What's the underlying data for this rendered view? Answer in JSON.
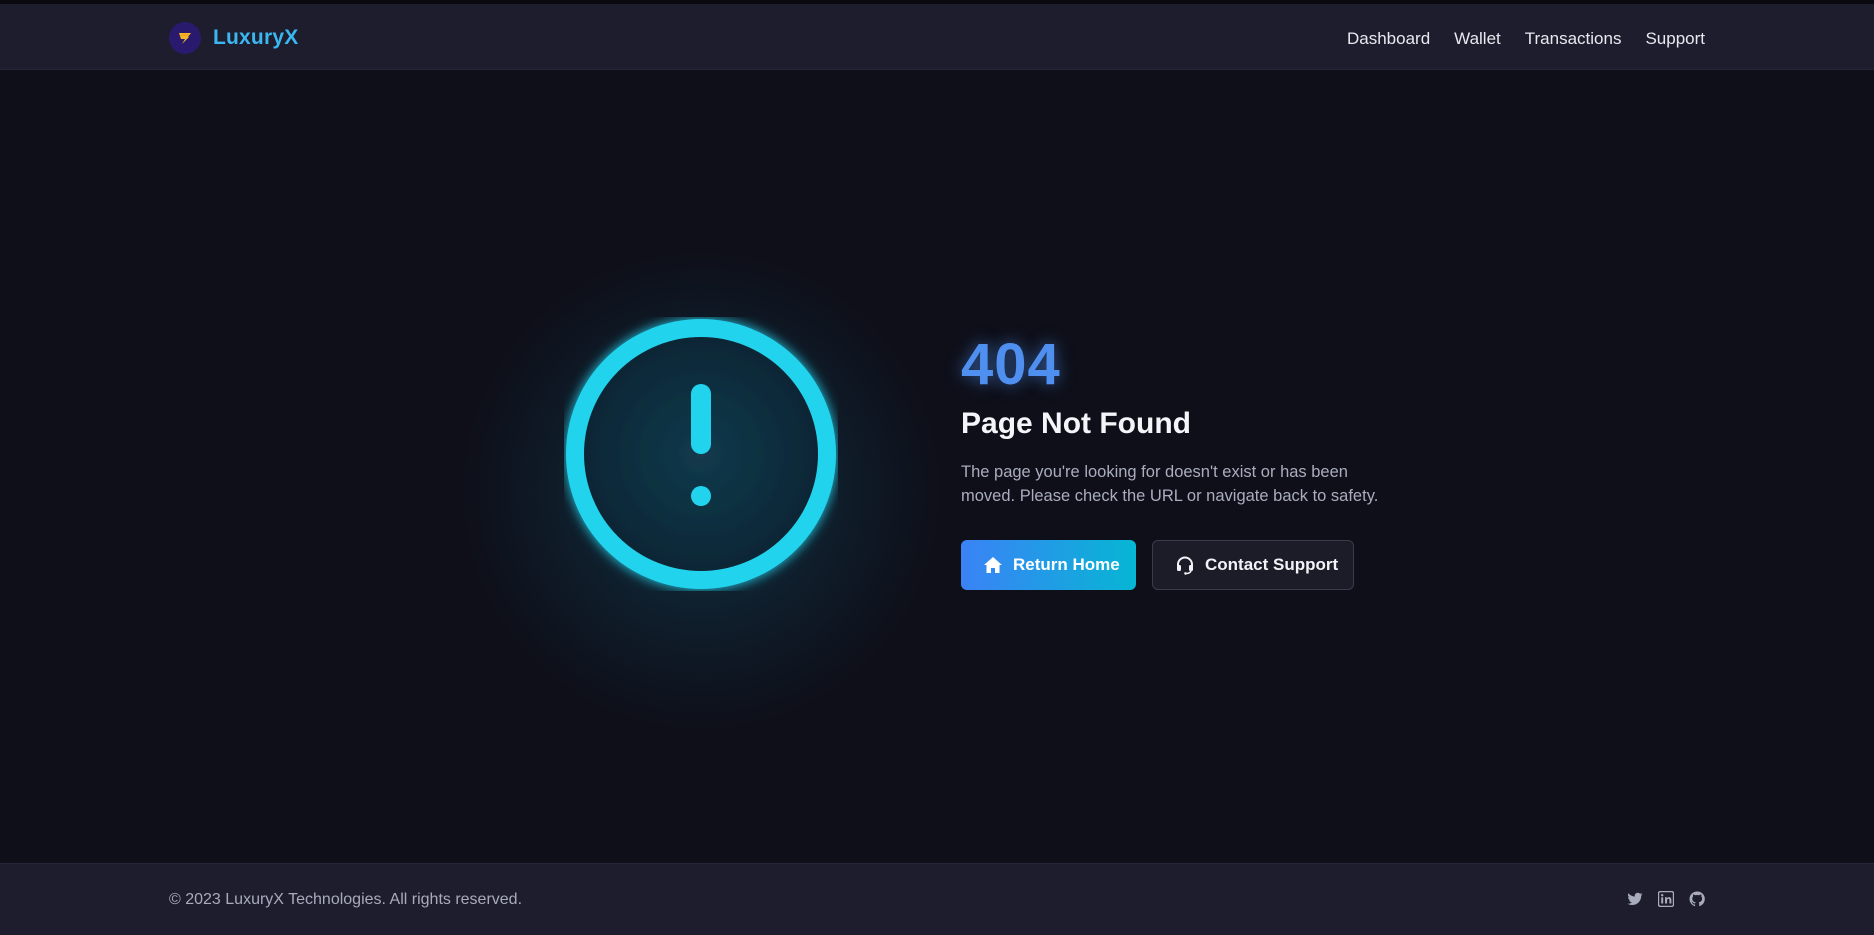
{
  "header": {
    "brand": "LuxuryX",
    "nav": [
      "Dashboard",
      "Wallet",
      "Transactions",
      "Support"
    ]
  },
  "error": {
    "code": "404",
    "title": "Page Not Found",
    "description": "The page you're looking for doesn't exist or has been moved. Please check the URL or navigate back to safety.",
    "primary_button": "Return Home",
    "secondary_button": "Contact Support"
  },
  "footer": {
    "copyright": "© 2023 LuxuryX Technologies. All rights reserved."
  },
  "icons": {
    "logo": "lightning-logo-icon",
    "alert": "exclamation-circle-icon",
    "home": "home-icon",
    "support": "headset-icon",
    "social": [
      "twitter-icon",
      "linkedin-icon",
      "github-icon"
    ]
  },
  "colors": {
    "background": "#0e0f19",
    "bar": "#1d1d2d",
    "accent_cyan": "#22d3ee",
    "accent_blue": "#4f8ff0",
    "brand": "#3bb6ee"
  }
}
